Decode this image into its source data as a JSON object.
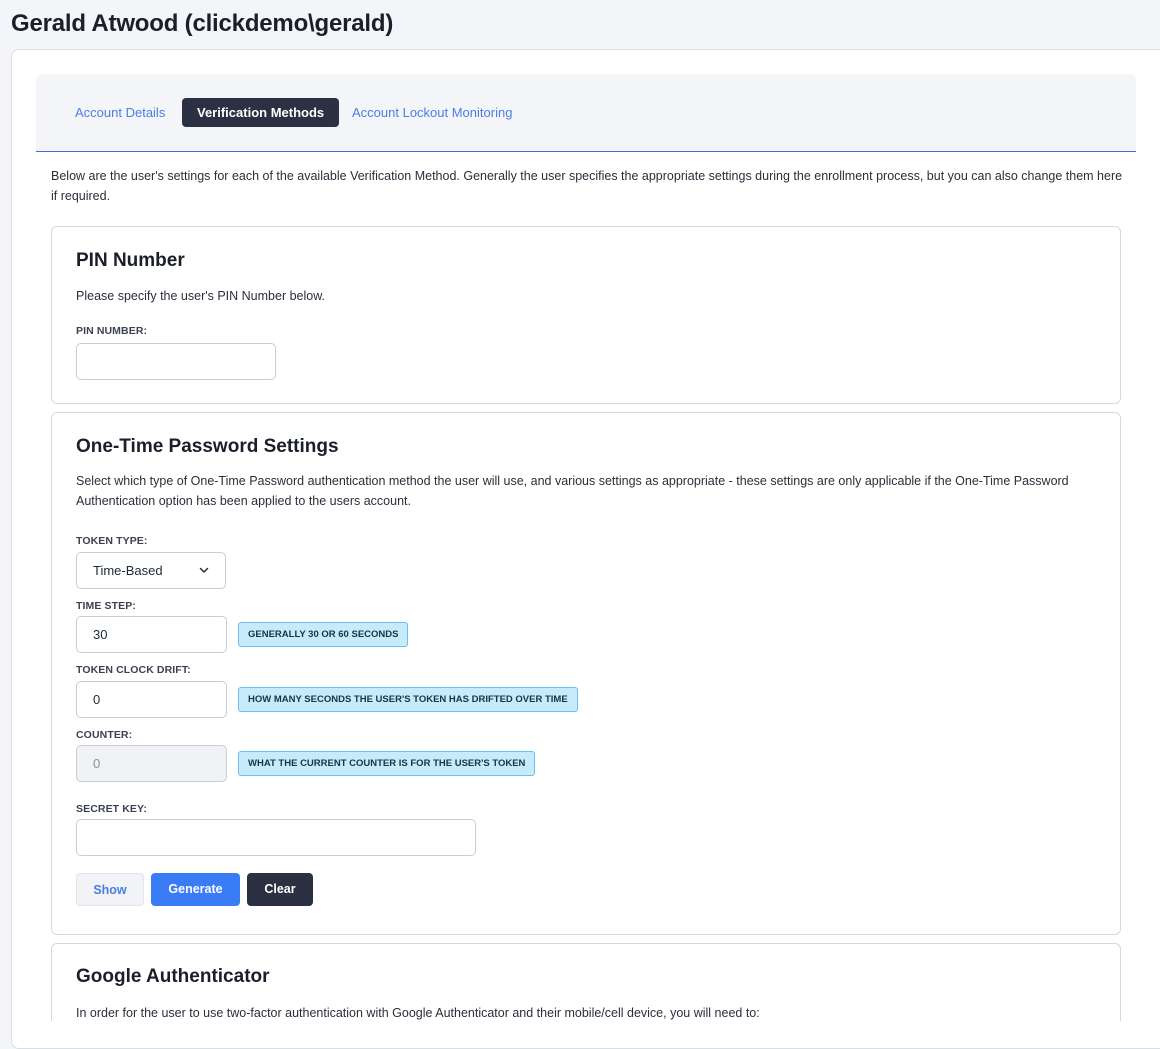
{
  "page": {
    "title": "Gerald Atwood (clickdemo\\gerald)"
  },
  "tabs": [
    {
      "label": "Account Details",
      "active": false
    },
    {
      "label": "Verification Methods",
      "active": true
    },
    {
      "label": "Account Lockout Monitoring",
      "active": false
    }
  ],
  "intro": "Below are the user's settings for each of the available Verification Method. Generally the user specifies the appropriate settings during the enrollment process, but you can also change them here if required.",
  "pin_section": {
    "title": "PIN Number",
    "description": "Please specify the user's PIN Number below.",
    "pin_label": "PIN NUMBER:",
    "pin_value": ""
  },
  "otp_section": {
    "title": "One-Time Password Settings",
    "description": "Select which type of One-Time Password authentication method the user will use, and various settings as appropriate - these settings are only applicable if the One-Time Password Authentication option has been applied to the users account.",
    "token_type_label": "TOKEN TYPE:",
    "token_type_value": "Time-Based",
    "time_step_label": "TIME STEP:",
    "time_step_value": "30",
    "time_step_hint": "GENERALLY 30 OR 60 SECONDS",
    "clock_drift_label": "TOKEN CLOCK DRIFT:",
    "clock_drift_value": "0",
    "clock_drift_hint": "HOW MANY SECONDS THE USER'S TOKEN HAS DRIFTED OVER TIME",
    "counter_label": "COUNTER:",
    "counter_value": "0",
    "counter_hint": "WHAT THE CURRENT COUNTER IS FOR THE USER'S TOKEN",
    "secret_key_label": "SECRET KEY:",
    "secret_key_value": "",
    "show_label": "Show",
    "generate_label": "Generate",
    "clear_label": "Clear"
  },
  "google_section": {
    "title": "Google Authenticator",
    "description": "In order for the user to use two-factor authentication with Google Authenticator and their mobile/cell device, you will need to:"
  },
  "icons": {
    "select_arrow": "chevron-down-icon"
  },
  "colors": {
    "accent_blue": "#3a7bf6",
    "link_blue": "#4a7fe0",
    "dark_navy": "#2b3142",
    "hint_bg": "#c7ebfb",
    "hint_border": "#67c3ec"
  }
}
